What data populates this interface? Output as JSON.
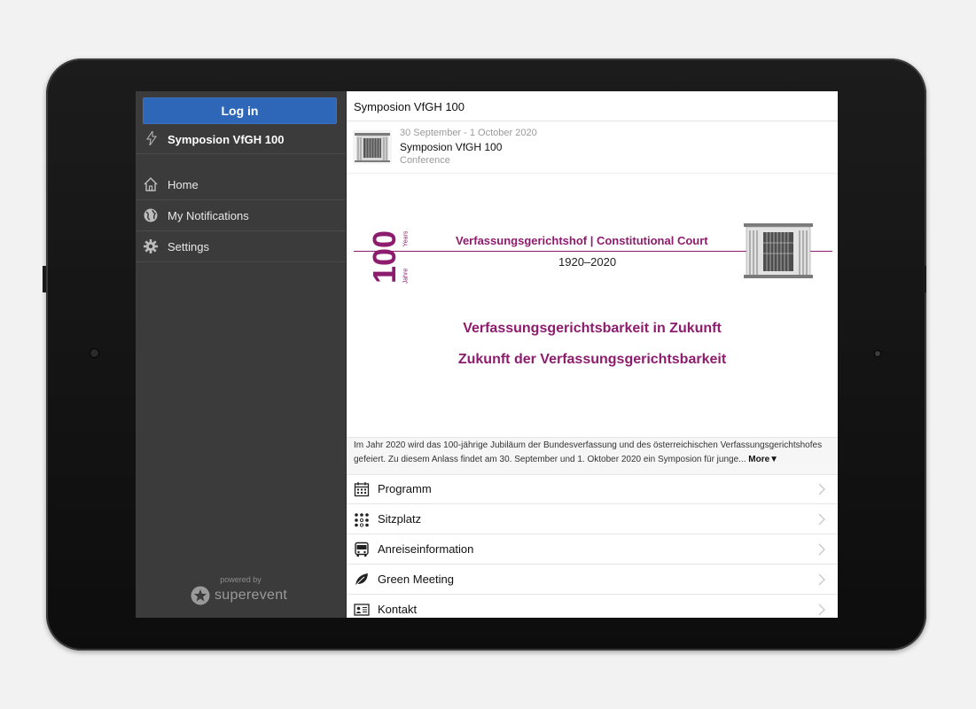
{
  "sidebar": {
    "login_label": "Log in",
    "event_name": "Symposion VfGH 100",
    "menu": [
      {
        "label": "Home",
        "icon": "home-icon"
      },
      {
        "label": "My Notifications",
        "icon": "globe-icon"
      },
      {
        "label": "Settings",
        "icon": "gear-icon"
      }
    ],
    "powered_by": "powered by",
    "brand": "superevent"
  },
  "main": {
    "title": "Symposion VfGH 100",
    "event": {
      "date": "30 September - 1 October 2020",
      "name": "Symposion VfGH 100",
      "type": "Conference"
    },
    "banner": {
      "number": "100",
      "vertical_jahre": "Jahre",
      "vertical_years": "Years",
      "court": "Verfassungsgerichtshof | Constitutional Court",
      "years": "1920–2020",
      "heading1": "Verfassungsgerichtsbarkeit in Zukunft",
      "heading2": "Zukunft der Verfassungsgerichtsbarkeit"
    },
    "description": "Im Jahr 2020 wird das 100-jährige Jubiläum der Bundesverfassung und des österreichischen Verfassungsgerichtshofes gefeiert. Zu diesem Anlass findet am 30. September und 1. Oktober 2020 ein Symposion für junge...",
    "more_label": "More▼",
    "items": [
      {
        "label": "Programm",
        "icon": "calendar-icon"
      },
      {
        "label": "Sitzplatz",
        "icon": "seating-icon"
      },
      {
        "label": "Anreiseinformation",
        "icon": "bus-icon"
      },
      {
        "label": "Green Meeting",
        "icon": "leaf-icon"
      },
      {
        "label": "Kontakt",
        "icon": "contact-card-icon"
      }
    ]
  },
  "colors": {
    "accent": "#2f67b8",
    "brand_purple": "#8e1c6e",
    "sidebar_bg": "#3b3b3b"
  }
}
